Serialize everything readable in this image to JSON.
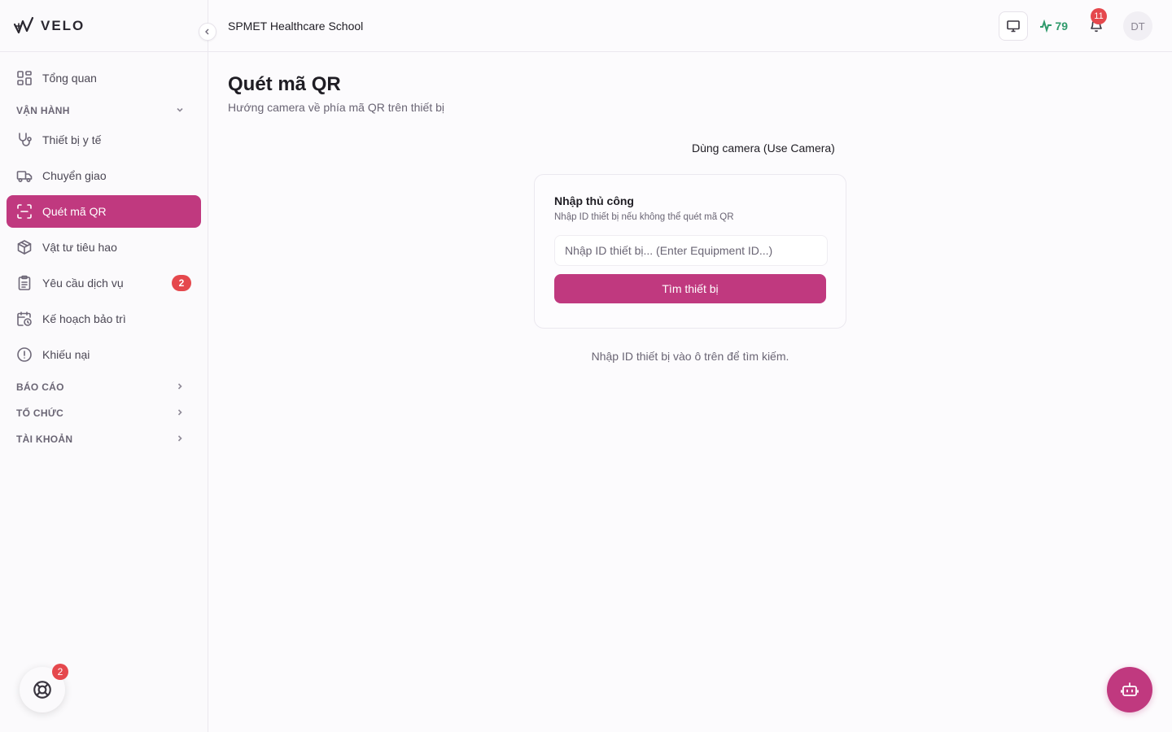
{
  "brand": {
    "name": "VELO"
  },
  "header": {
    "org_name": "SPMET Healthcare School",
    "score": "79",
    "notification_count": "11",
    "avatar_initials": "DT"
  },
  "sidebar": {
    "items": [
      {
        "label": "Tổng quan",
        "icon": "dashboard-icon"
      },
      {
        "label": "Thiết bị y tế",
        "icon": "stethoscope-icon"
      },
      {
        "label": "Chuyển giao",
        "icon": "truck-icon"
      },
      {
        "label": "Quét mã QR",
        "icon": "scan-icon",
        "active": true
      },
      {
        "label": "Vật tư tiêu hao",
        "icon": "box-icon"
      },
      {
        "label": "Yêu cầu dịch vụ",
        "icon": "clipboard-icon",
        "badge": "2"
      },
      {
        "label": "Kế hoạch bảo trì",
        "icon": "calendar-clock-icon"
      },
      {
        "label": "Khiếu nại",
        "icon": "alert-circle-icon"
      }
    ],
    "sections": {
      "van_hanh": "VẬN HÀNH",
      "bao_cao": "BÁO CÁO",
      "to_chuc": "TỔ CHỨC",
      "tai_khoan": "TÀI KHOẢN"
    },
    "help_badge": "2"
  },
  "main": {
    "title": "Quét mã QR",
    "subtitle": "Hướng camera về phía mã QR trên thiết bị",
    "camera_link": "Dùng camera (Use Camera)",
    "manual": {
      "title": "Nhập thủ công",
      "description": "Nhập ID thiết bị nếu không thể quét mã QR",
      "input_placeholder": "Nhập ID thiết bị... (Enter Equipment ID...)",
      "input_value": "",
      "button_label": "Tìm thiết bị"
    },
    "hint": "Nhập ID thiết bị vào ô trên để tìm kiếm."
  },
  "colors": {
    "accent": "#c0397f",
    "badge": "#e5484d",
    "score": "#2f9a6b"
  }
}
